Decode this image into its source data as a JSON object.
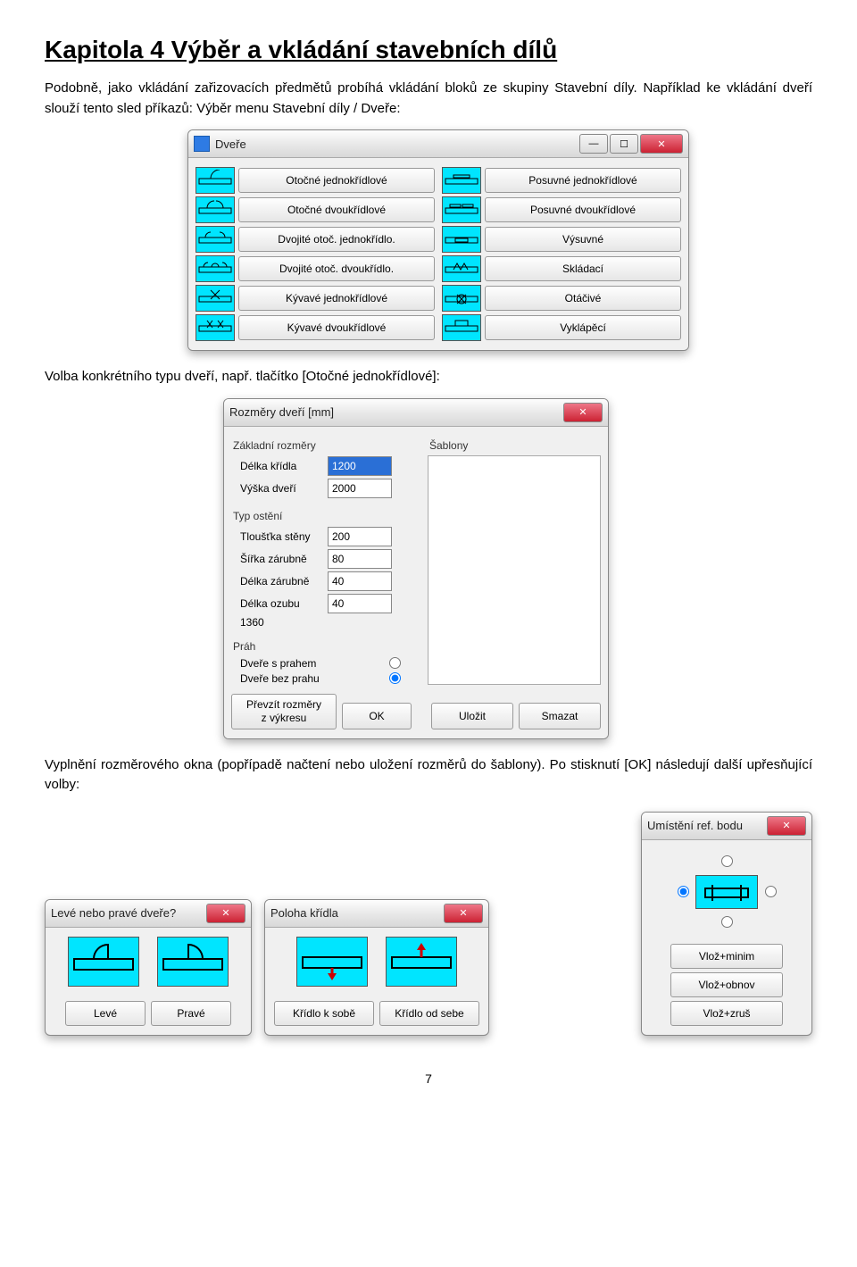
{
  "heading": "Kapitola 4  Výběr a vkládání stavebních dílů",
  "para1": "Podobně, jako vkládání zařizovacích předmětů probíhá vkládání bloků ze skupiny Stavební díly. Například ke vkládání dveří slouží tento sled příkazů: Výběr menu Stavební díly / Dveře:",
  "para2": "Volba konkrétního typu dveří, např. tlačítko [Otočné jednokřídlové]:",
  "para3": "Vyplnění rozměrového okna (popřípadě načtení nebo uložení rozměrů do šablony). Po stisknutí [OK] následují další upřesňující volby:",
  "page_number": "7",
  "dvere": {
    "title": "Dveře",
    "left": [
      "Otočné jednokřídlové",
      "Otočné dvoukřídlové",
      "Dvojité otoč. jednokřídlo.",
      "Dvojité otoč. dvoukřídlo.",
      "Kývavé jednokřídlové",
      "Kývavé dvoukřídlové"
    ],
    "right": [
      "Posuvné jednokřídlové",
      "Posuvné dvoukřídlové",
      "Výsuvné",
      "Skládací",
      "Otáčivé",
      "Vyklápěcí"
    ]
  },
  "rozm": {
    "title": "Rozměry dveří [mm]",
    "group1": "Základní rozměry",
    "sablony": "Šablony",
    "fields": {
      "delka_kridla": {
        "label": "Délka křídla",
        "value": "1200"
      },
      "vyska_dveri": {
        "label": "Výška dveří",
        "value": "2000"
      }
    },
    "group2": "Typ ostění",
    "fields2": {
      "tloustka_steny": {
        "label": "Tloušťka stěny",
        "value": "200"
      },
      "sirka_zarubne": {
        "label": "Šířka zárubně",
        "value": "80"
      },
      "delka_zarubne": {
        "label": "Délka zárubně",
        "value": "40"
      },
      "delka_ozubu": {
        "label": "Délka ozubu",
        "value": "40"
      },
      "computed": "1360"
    },
    "group3": "Práh",
    "radios": {
      "s_prahem": "Dveře s prahem",
      "bez_prahu": "Dveře bez prahu"
    },
    "footer": {
      "prevzit": "Převzít rozměry\nz výkresu",
      "ok": "OK",
      "ulozit": "Uložit",
      "smazat": "Smazat"
    }
  },
  "leve_prave": {
    "title": "Levé nebo pravé dveře?",
    "leve": "Levé",
    "prave": "Pravé"
  },
  "poloha": {
    "title": "Poloha křídla",
    "k_sobe": "Křídlo k sobě",
    "od_sebe": "Křídlo od sebe"
  },
  "refbod": {
    "title": "Umístění ref. bodu",
    "btn1": "Vlož+minim",
    "btn2": "Vlož+obnov",
    "btn3": "Vlož+zruš"
  }
}
